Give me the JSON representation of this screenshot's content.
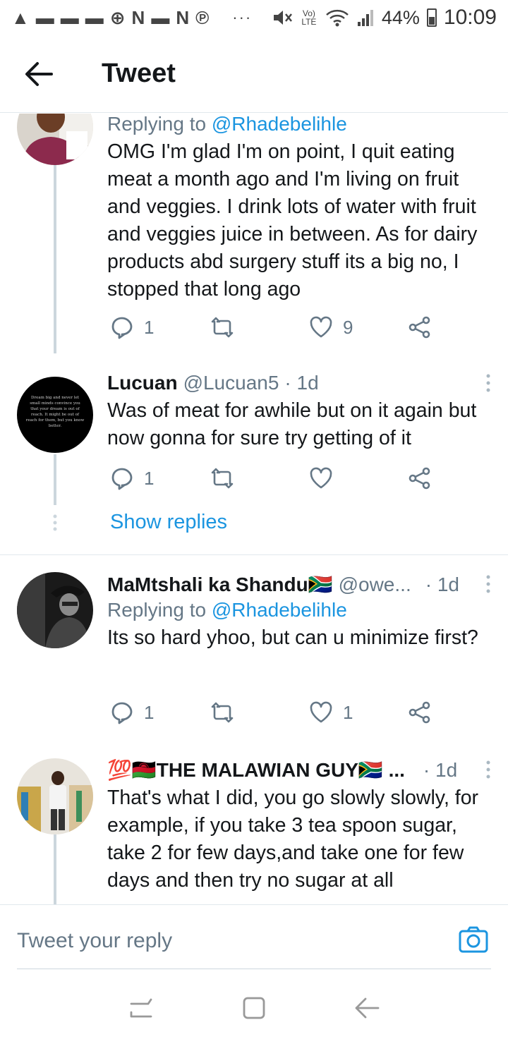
{
  "status_bar": {
    "notif_glyphs": [
      "▲",
      "▬",
      "▬",
      "▬",
      "⊕",
      "N",
      "▬",
      "N",
      "℗"
    ],
    "more": "···",
    "network": "Vo) LTE",
    "battery": "44%",
    "time": "10:09"
  },
  "header": {
    "title": "Tweet"
  },
  "tweets": [
    {
      "replying_prefix": "Replying to",
      "replying_to": "@Rhadebelihle",
      "text": "OMG I'm glad I'm on point, I quit eating meat a month ago and I'm living on fruit and veggies. I drink lots of water with fruit and veggies juice in between. As for dairy products abd surgery stuff its a big no, I stopped that long ago",
      "replies": "1",
      "retweets": "",
      "likes": "9"
    },
    {
      "name": "Lucuan",
      "handle": "@Lucuan5",
      "time": "· 1d",
      "text": "Was of meat for awhile but on it again but now gonna for sure try getting of it",
      "replies": "1",
      "retweets": "",
      "likes": "",
      "avatar_text": "Dream big and never let small minds convince you that your dream is out of reach. It might be out of reach for them, but you know better."
    },
    {
      "name": "MaMtshali ka Shandu🇿🇦",
      "handle": "@owe...",
      "time": "· 1d",
      "replying_prefix": "Replying to",
      "replying_to": "@Rhadebelihle",
      "text": "Its so hard yhoo, but can u minimize first?",
      "replies": "1",
      "retweets": "",
      "likes": "1"
    },
    {
      "name": "💯🇲🇼THE MALAWIAN GUY🇿🇦 ...",
      "time": "· 1d",
      "text": "That's what I did, you go slowly slowly, for example, if you take 3 tea spoon sugar, take 2 for few days,and take one for few days and then try no sugar at all"
    }
  ],
  "show_replies": "Show replies",
  "reply_bar": {
    "placeholder": "Tweet your reply"
  },
  "colors": {
    "accent": "#1b95e0",
    "secondary_text": "#657786",
    "thread_line": "#ccd6dd"
  }
}
